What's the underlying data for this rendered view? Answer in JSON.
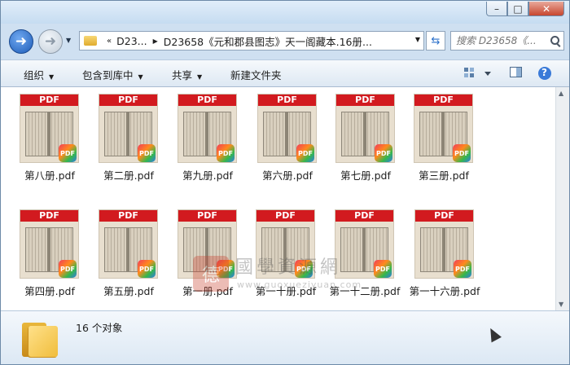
{
  "window": {
    "buttons": {
      "minimize": "–",
      "maximize": "□",
      "close": "✕"
    }
  },
  "nav": {
    "back_icon": "back-arrow-icon",
    "forward_icon": "forward-arrow-icon",
    "breadcrumb": {
      "overflow": "«",
      "first": "D23...",
      "current": "D23658《元和郡县图志》天一阁藏本.16册..."
    },
    "search_placeholder": "搜索 D23658《..."
  },
  "toolbar": {
    "organize": "组织",
    "include_in_library": "包含到库中",
    "share": "共享",
    "new_folder": "新建文件夹",
    "help": "?"
  },
  "files": [
    {
      "name": "第八册.pdf",
      "band": "PDF",
      "badge": "PDF"
    },
    {
      "name": "第二册.pdf",
      "band": "PDF",
      "badge": "PDF"
    },
    {
      "name": "第九册.pdf",
      "band": "PDF",
      "badge": "PDF"
    },
    {
      "name": "第六册.pdf",
      "band": "PDF",
      "badge": "PDF"
    },
    {
      "name": "第七册.pdf",
      "band": "PDF",
      "badge": "PDF"
    },
    {
      "name": "第三册.pdf",
      "band": "PDF",
      "badge": "PDF"
    },
    {
      "name": "第四册.pdf",
      "band": "PDF",
      "badge": "PDF"
    },
    {
      "name": "第五册.pdf",
      "band": "PDF",
      "badge": "PDF"
    },
    {
      "name": "第一册.pdf",
      "band": "PDF",
      "badge": "PDF"
    },
    {
      "name": "第一十册.pdf",
      "band": "PDF",
      "badge": "PDF"
    },
    {
      "name": "第一十二册.pdf",
      "band": "PDF",
      "badge": "PDF"
    },
    {
      "name": "第一十六册.pdf",
      "band": "PDF",
      "badge": "PDF"
    }
  ],
  "watermark": {
    "seal": "德",
    "title": "國學資源網",
    "url": "www.guoxueziyuan.com"
  },
  "details": {
    "count_text": "16 个对象"
  },
  "colors": {
    "pdf_band": "#d21a1f",
    "window_chrome": "#cfe0f1",
    "accent_blue": "#1d5cb8"
  }
}
